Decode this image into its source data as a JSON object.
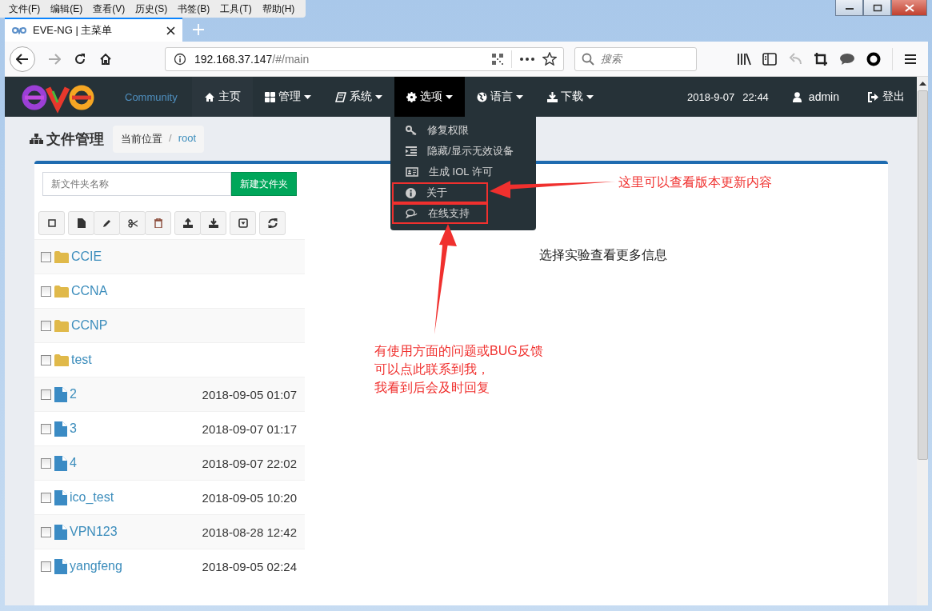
{
  "browser": {
    "menu_bar": [
      "文件(F)",
      "编辑(E)",
      "查看(V)",
      "历史(S)",
      "书签(B)",
      "工具(T)",
      "帮助(H)"
    ],
    "tab": {
      "title": "EVE-NG | 主菜单"
    },
    "address": {
      "host": "192.168.37.147",
      "path": "/#/main"
    },
    "search": {
      "placeholder": "搜索"
    }
  },
  "navbar": {
    "brand": "Community",
    "items": [
      {
        "label": "主页",
        "caret": false,
        "selected": false
      },
      {
        "label": "管理",
        "caret": true,
        "selected": false
      },
      {
        "label": "系统",
        "caret": true,
        "selected": false
      },
      {
        "label": "选项",
        "caret": true,
        "selected": true
      },
      {
        "label": "语言",
        "caret": true,
        "selected": false
      },
      {
        "label": "下载",
        "caret": true,
        "selected": false
      }
    ],
    "date": "2018-9-07",
    "time": "22:44",
    "user": "admin",
    "logout": "登出"
  },
  "dropdown": {
    "items": [
      {
        "label": "修复权限",
        "annotated": false
      },
      {
        "label": "隐藏/显示无效设备",
        "annotated": false
      },
      {
        "label": "生成 IOL 许可",
        "annotated": false
      },
      {
        "label": "关于",
        "annotated": true
      },
      {
        "label": "在线支持",
        "annotated": true
      }
    ]
  },
  "page": {
    "title": "文件管理",
    "separator": "/",
    "breadcrumb": [
      {
        "label": "当前位置",
        "link": false
      },
      {
        "label": "root",
        "link": true
      }
    ]
  },
  "new_folder": {
    "placeholder": "新文件夹名称",
    "button": "新建文件夹"
  },
  "files": [
    {
      "kind": "folder",
      "name": "CCIE",
      "checked": false
    },
    {
      "kind": "folder",
      "name": "CCNA",
      "checked": false
    },
    {
      "kind": "folder",
      "name": "CCNP",
      "checked": false
    },
    {
      "kind": "folder",
      "name": "test",
      "checked": false
    },
    {
      "kind": "file",
      "name": "2",
      "modified": "2018-09-05 01:07",
      "checked": false
    },
    {
      "kind": "file",
      "name": "3",
      "modified": "2018-09-07 01:17",
      "checked": false
    },
    {
      "kind": "file",
      "name": "4",
      "modified": "2018-09-07 22:02",
      "checked": false
    },
    {
      "kind": "file",
      "name": "ico_test",
      "modified": "2018-09-05 10:20",
      "checked": false
    },
    {
      "kind": "file",
      "name": "VPN123",
      "modified": "2018-08-28 12:42",
      "checked": false
    },
    {
      "kind": "file",
      "name": "yangfeng",
      "modified": "2018-09-05 02:24",
      "checked": false
    }
  ],
  "hint": "选择实验查看更多信息",
  "annotations": {
    "about_note": "这里可以查看版本更新内容",
    "support_note": [
      "有使用方面的问题或BUG反馈",
      "可以点此联系到我，",
      "我看到后会及时回复"
    ]
  }
}
